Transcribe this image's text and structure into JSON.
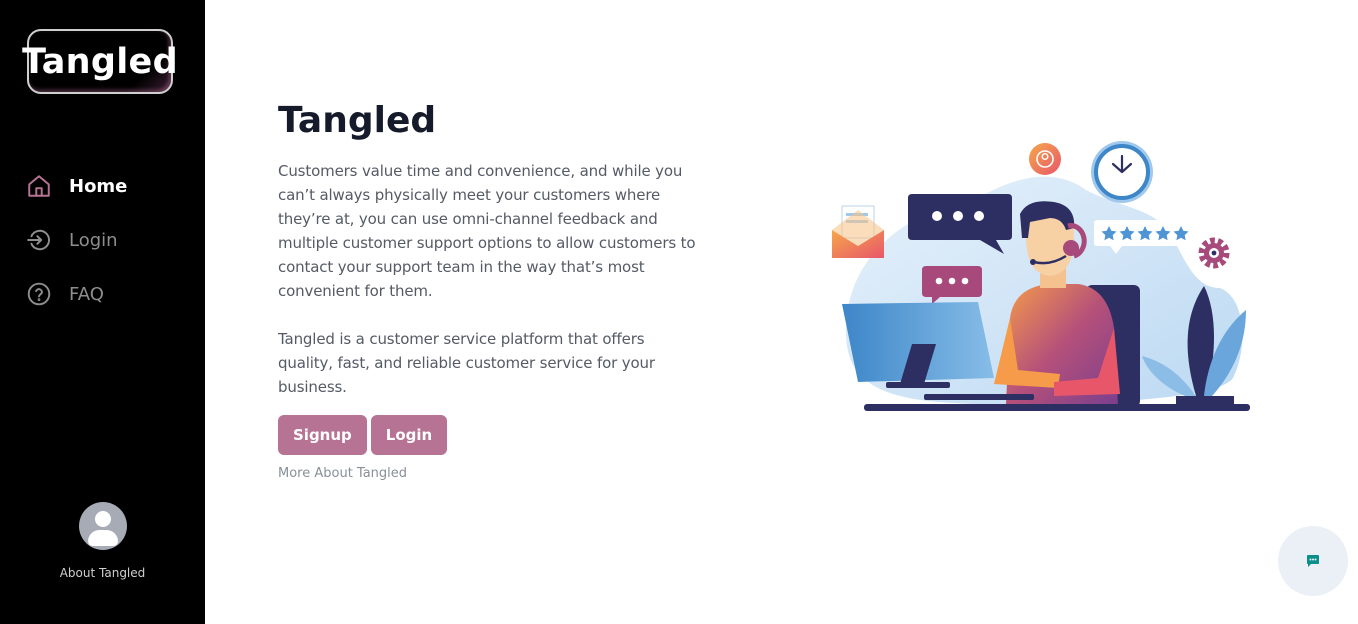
{
  "sidebar": {
    "logo_text": "Tangled",
    "items": [
      {
        "label": "Home",
        "icon": "home-icon",
        "active": true
      },
      {
        "label": "Login",
        "icon": "login-icon",
        "active": false
      },
      {
        "label": "FAQ",
        "icon": "question-icon",
        "active": false
      }
    ],
    "about_label": "About Tangled"
  },
  "main": {
    "title": "Tangled",
    "paragraph1": "Customers value time and convenience, and while you can’t always physically meet your customers where they’re at, you can use omni-channel feedback and multiple customer support options to allow customers to contact your support team in the way that’s most convenient for them.",
    "paragraph2": "Tangled is a customer service platform that offers quality, fast, and reliable customer service for your business.",
    "signup_label": "Signup",
    "login_label": "Login",
    "more_link": "More About Tangled"
  },
  "illustration": {
    "subject": "customer support agent with headset at computer",
    "icons": [
      "envelope-icon",
      "chat-bubble-icon",
      "clock-icon",
      "user-icon",
      "rating-stars-icon",
      "gear-icon",
      "plant-icon"
    ]
  },
  "chat_widget": {
    "icon": "chat-icon"
  },
  "colors": {
    "accent": "#b77394",
    "sidebar_bg": "#000000",
    "title": "#151b2b",
    "body_text": "#555a66",
    "nav_inactive": "#8e8e8e"
  }
}
